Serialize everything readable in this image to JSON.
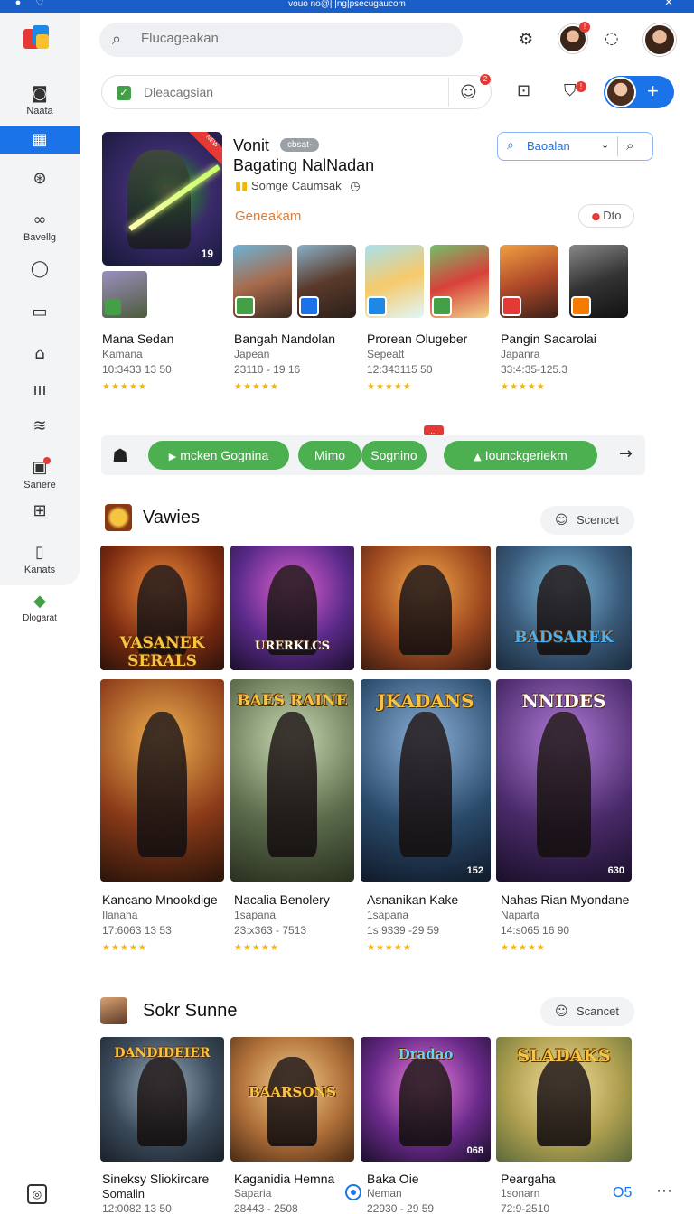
{
  "top_strip": {
    "title": "vouo no@| |ng|psecugaucom"
  },
  "colors": {
    "accent": "#1a73e8",
    "green": "#4caf50",
    "orange": "#e07a2f",
    "star": "#f2b705"
  },
  "sidebar": {
    "items": [
      {
        "icon": "camera-icon",
        "label": "Naata"
      },
      {
        "icon": "grid-icon",
        "label": ""
      },
      {
        "icon": "compass-icon",
        "label": ""
      },
      {
        "icon": "group-icon",
        "label": "Bavellg"
      },
      {
        "icon": "chat-icon",
        "label": ""
      },
      {
        "icon": "window-icon",
        "label": ""
      },
      {
        "icon": "home-icon",
        "label": ""
      },
      {
        "icon": "chart-icon",
        "label": ""
      },
      {
        "icon": "layers-icon",
        "label": ""
      },
      {
        "icon": "image-icon",
        "label": "Sanere"
      },
      {
        "icon": "frame-icon",
        "label": ""
      },
      {
        "icon": "bookmark-icon",
        "label": "Kanats"
      },
      {
        "icon": "diamond-icon",
        "label": "Dlogarat"
      }
    ]
  },
  "header": {
    "search_placeholder": "Flucageakan",
    "search2_placeholder": "Dleacagsian"
  },
  "featured": {
    "title": "Vonit",
    "tag": "cbsat-",
    "subtitle": "Bagating NalNadan",
    "developer": "Somge Caumsak",
    "genre": "Geneakam",
    "badge_number": "19",
    "filter_label": "Baoalan",
    "chip_label": "Dto"
  },
  "featured_row": [
    {
      "title": "Mana Sedan",
      "sub": "Kamana",
      "nums": "10:3433 13 50",
      "stars": "★★★★★"
    },
    {
      "title": "Bangah Nandolan",
      "sub": "Japean",
      "nums": "23110 - 19 16",
      "stars": "★★★★★"
    },
    {
      "title": "Prorean Olugeber",
      "sub": "Sepeatt",
      "nums": "12:343115 50",
      "stars": "★★★★★"
    },
    {
      "title": "Pangin Sacarolai",
      "sub": "Japanra",
      "nums": "33:4:35-125.3",
      "stars": "★★★★★"
    }
  ],
  "action_bar": {
    "buttons": [
      "mcken Gognina",
      "Mimo",
      "Sognino",
      "Iounckgeriekm"
    ],
    "flag": "..."
  },
  "section1": {
    "title": "Vawies",
    "button": "Scencet",
    "top_tiles": [
      {
        "logo": "VASANEK SERALS"
      },
      {
        "logo": "URERKLCS"
      },
      {
        "logo": ""
      },
      {
        "logo": "BADSAREK"
      }
    ],
    "cards": [
      {
        "title": "Kancano Mnookdige",
        "sub": "Ilanana",
        "nums": "17:6063 13 53",
        "stars": "★★★★★",
        "logo": "",
        "count": ""
      },
      {
        "title": "Nacalia Benolery",
        "sub": "1sapana",
        "nums": "23:x363 - 7513",
        "stars": "★★★★★",
        "logo": "BAES RAINE",
        "count": ""
      },
      {
        "title": "Asnanikan Kake",
        "sub": "1sapana",
        "nums": "1s 9339 -29 59",
        "stars": "★★★★★",
        "logo": "JKADANS",
        "count": "152"
      },
      {
        "title": "Nahas Rian Myondane",
        "sub": "Naparta",
        "nums": "14:s065 16 90",
        "stars": "★★★★★",
        "logo": "NNIDES",
        "count": "630"
      }
    ]
  },
  "section2": {
    "title": "Sokr Sunne",
    "button": "Scancet",
    "cards": [
      {
        "title": "Sineksy Sliokircare",
        "sub": "Somalin",
        "nums": "12:0082 13 50",
        "logo": "DANDIDEIER",
        "count": ""
      },
      {
        "title": "Kaganidia Hemna",
        "sub": "Saparia",
        "nums": "28443 - 2508",
        "logo": "BAARSONS",
        "count": ""
      },
      {
        "title": "Baka Oie",
        "sub": "Neman",
        "nums": "22930 - 29 59",
        "logo": "Dradao",
        "count": "068"
      },
      {
        "title": "Peargaha",
        "sub": "1sonarn",
        "nums": "72:9-2510",
        "logo": "SLADAKS",
        "count": ""
      }
    ]
  },
  "bottom_bar": {
    "os_label": "O5"
  }
}
